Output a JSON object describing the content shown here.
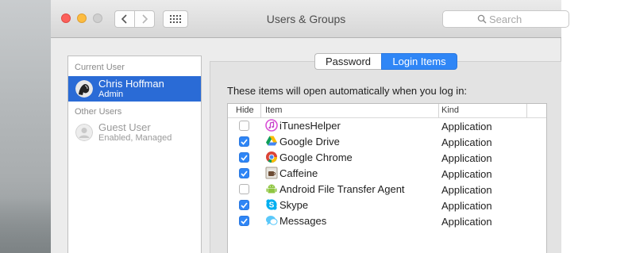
{
  "window": {
    "title": "Users & Groups"
  },
  "toolbar": {
    "search_placeholder": "Search"
  },
  "sidebar": {
    "current_user_header": "Current User",
    "current_user": {
      "name": "Chris Hoffman",
      "role": "Admin"
    },
    "other_users_header": "Other Users",
    "guest_user": {
      "name": "Guest User",
      "status": "Enabled, Managed"
    }
  },
  "tabs": [
    {
      "label": "Password",
      "selected": false
    },
    {
      "label": "Login Items",
      "selected": true
    }
  ],
  "login_items": {
    "intro": "These items will open automatically when you log in:",
    "columns": {
      "hide": "Hide",
      "item": "Item",
      "kind": "Kind"
    },
    "rows": [
      {
        "hide": false,
        "name": "iTunesHelper",
        "kind": "Application",
        "icon": "itunes-icon"
      },
      {
        "hide": true,
        "name": "Google Drive",
        "kind": "Application",
        "icon": "google-drive-icon"
      },
      {
        "hide": true,
        "name": "Google Chrome",
        "kind": "Application",
        "icon": "google-chrome-icon"
      },
      {
        "hide": true,
        "name": "Caffeine",
        "kind": "Application",
        "icon": "caffeine-icon"
      },
      {
        "hide": false,
        "name": "Android File Transfer Agent",
        "kind": "Application",
        "icon": "android-icon"
      },
      {
        "hide": true,
        "name": "Skype",
        "kind": "Application",
        "icon": "skype-icon"
      },
      {
        "hide": true,
        "name": "Messages",
        "kind": "Application",
        "icon": "messages-icon"
      }
    ]
  },
  "colors": {
    "selection_blue": "#2a6bd6",
    "segment_blue": "#2f86f6",
    "close": "#fc605b",
    "minimize": "#fdbc40"
  }
}
